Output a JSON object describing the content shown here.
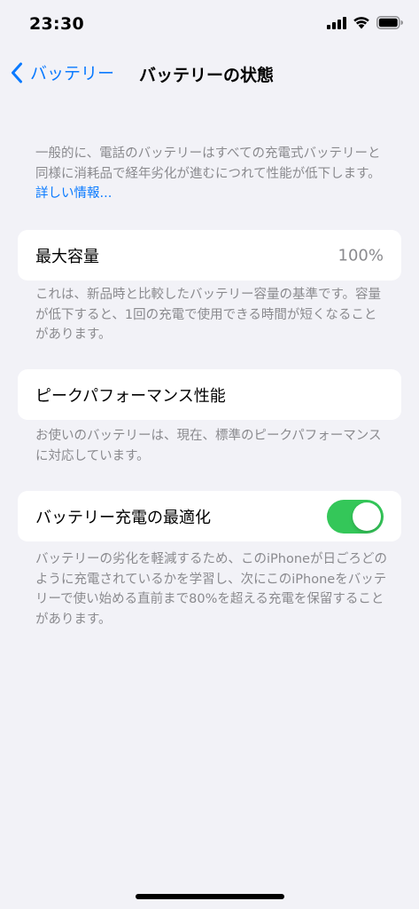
{
  "status_bar": {
    "time": "23:30",
    "icons": [
      "cellular-signal-icon",
      "wifi-icon",
      "battery-icon"
    ]
  },
  "nav": {
    "back_label": "バッテリー",
    "back_icon": "chevron-left-icon",
    "title": "バッテリーの状態"
  },
  "intro": {
    "text": "一般的に、電話のバッテリーはすべての充電式バッテリーと同様に消耗品で経年劣化が進むにつれて性能が低下します。",
    "link": "詳しい情報..."
  },
  "max_capacity": {
    "label": "最大容量",
    "value": "100%",
    "footnote": "これは、新品時と比較したバッテリー容量の基準です。容量が低下すると、1回の充電で使用できる時間が短くなることがあります。"
  },
  "peak_performance": {
    "label": "ピークパフォーマンス性能",
    "footnote": "お使いのバッテリーは、現在、標準のピークパフォーマンスに対応しています。"
  },
  "optimized_charging": {
    "label": "バッテリー充電の最適化",
    "enabled": true,
    "footnote": "バッテリーの劣化を軽減するため、このiPhoneが日ごろどのように充電されているかを学習し、次にこのiPhoneをバッテリーで使い始める直前まで80%を超える充電を保留することがあります。"
  },
  "colors": {
    "accent": "#0a7aff",
    "toggle_on": "#34c759",
    "background": "#f2f2f7",
    "secondary_text": "#8a8a8e"
  }
}
